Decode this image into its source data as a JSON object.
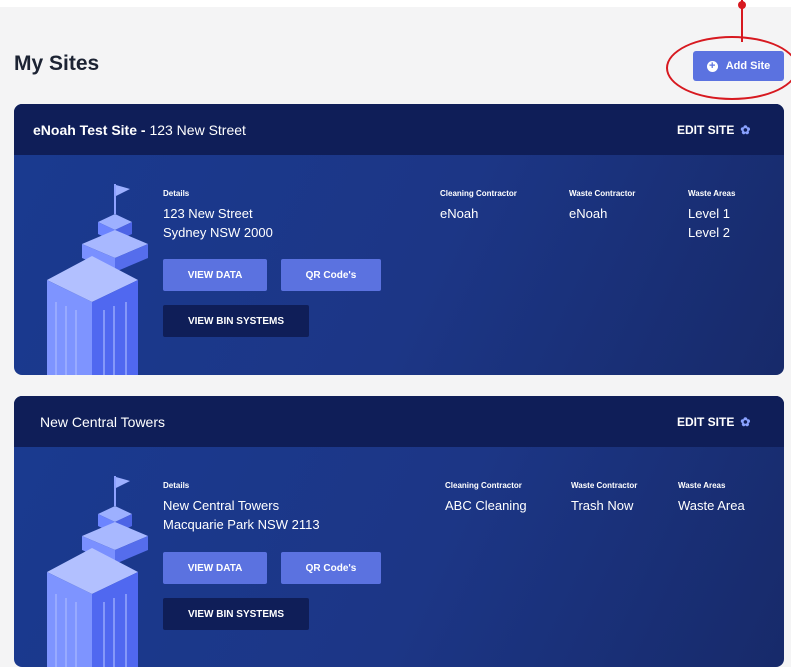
{
  "header": {
    "title": "My Sites",
    "add_label": "Add Site",
    "add_icon": "plus-circle-icon"
  },
  "colors": {
    "accent": "#5b72e0",
    "card_header": "#0f1e58",
    "annotation": "#d71920"
  },
  "columns": {
    "details": "Details",
    "cleaning": "Cleaning Contractor",
    "waste": "Waste Contractor",
    "areas": "Waste Areas"
  },
  "sites": [
    {
      "name_bold": "eNoah Test Site - ",
      "name_rest": "123 New Street",
      "edit_label": "EDIT SITE",
      "details_line1": "123 New Street",
      "details_line2": "Sydney NSW 2000",
      "cleaning_contractor": "eNoah",
      "waste_contractor": "eNoah",
      "waste_areas": [
        "Level 1",
        "Level 2"
      ],
      "view_data_label": "VIEW DATA",
      "qr_label": "QR Code's",
      "bin_label": "VIEW BIN SYSTEMS"
    },
    {
      "name_bold": "",
      "name_rest": "New Central Towers",
      "edit_label": "EDIT SITE",
      "details_line1": "New Central Towers",
      "details_line2": "Macquarie Park NSW 2113",
      "cleaning_contractor": "ABC Cleaning",
      "waste_contractor": "Trash Now",
      "waste_areas": [
        "Waste Area"
      ],
      "view_data_label": "VIEW DATA",
      "qr_label": "QR Code's",
      "bin_label": "VIEW BIN SYSTEMS"
    }
  ]
}
